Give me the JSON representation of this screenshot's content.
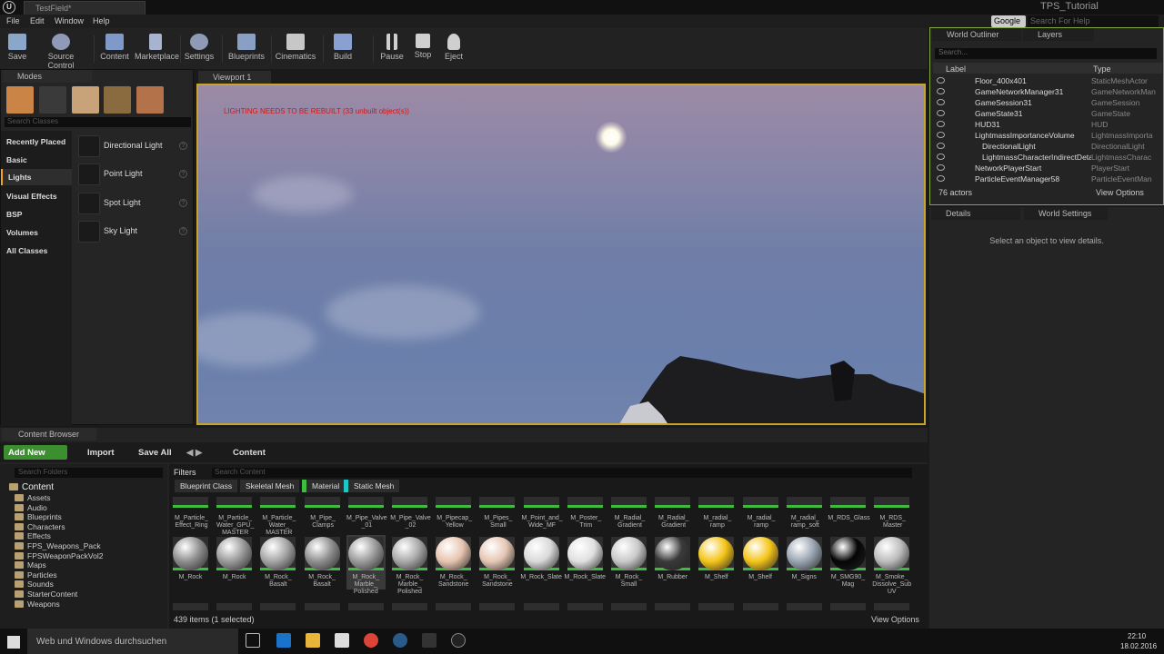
{
  "window": {
    "document_tab": "TestField*",
    "project_title": "TPS_Tutorial"
  },
  "menu": [
    "File",
    "Edit",
    "Window",
    "Help"
  ],
  "search_help": {
    "provider": "Google",
    "placeholder": "Search For Help"
  },
  "toolbar": [
    {
      "label": "Save",
      "icon": "save-icon",
      "color": "#8aa6c8"
    },
    {
      "label": "Source Control",
      "icon": "source-control-icon",
      "color": "#8e9ab8"
    },
    {
      "label": "Content",
      "icon": "content-icon",
      "color": "#7f9ac9"
    },
    {
      "label": "Marketplace",
      "icon": "marketplace-icon",
      "color": "#a8b4cf"
    },
    {
      "label": "Settings",
      "icon": "settings-icon",
      "color": "#8f9bb6"
    },
    {
      "label": "Blueprints",
      "icon": "blueprints-icon",
      "color": "#8a9fc4"
    },
    {
      "label": "Cinematics",
      "icon": "cinematics-icon",
      "color": "#c7c7c7"
    },
    {
      "label": "Build",
      "icon": "build-icon",
      "color": "#8aa0d0"
    },
    {
      "label": "Pause",
      "icon": "pause-icon",
      "color": "#cfcfcf"
    },
    {
      "label": "Stop",
      "icon": "stop-icon",
      "color": "#cfcfcf"
    },
    {
      "label": "Eject",
      "icon": "eject-icon",
      "color": "#cfcfcf"
    }
  ],
  "modes": {
    "tab": "Modes",
    "search_placeholder": "Search Classes",
    "categories": [
      "Recently Placed",
      "Basic",
      "Lights",
      "Visual Effects",
      "BSP",
      "Volumes",
      "All Classes"
    ],
    "selected_category": "Lights",
    "items": [
      "Directional Light",
      "Point Light",
      "Spot Light",
      "Sky Light"
    ]
  },
  "viewport": {
    "tab": "Viewport 1",
    "warning": "LIGHTING NEEDS TO BE REBUILT (33 unbuilt object(s))"
  },
  "outliner": {
    "tabs": [
      "World Outliner",
      "Layers"
    ],
    "search_placeholder": "Search...",
    "columns": [
      "Label",
      "Type"
    ],
    "rows": [
      {
        "label": "Floor_400x401",
        "type": "StaticMeshActor",
        "indent": 0
      },
      {
        "label": "GameNetworkManager31",
        "type": "GameNetworkMan",
        "indent": 0
      },
      {
        "label": "GameSession31",
        "type": "GameSession",
        "indent": 0
      },
      {
        "label": "GameState31",
        "type": "GameState",
        "indent": 0
      },
      {
        "label": "HUD31",
        "type": "HUD",
        "indent": 0
      },
      {
        "label": "LightmassImportanceVolume",
        "type": "LightmassImporta",
        "indent": 0
      },
      {
        "label": "DirectionalLight",
        "type": "DirectionalLight",
        "indent": 1
      },
      {
        "label": "LightmassCharacterIndirectDetai",
        "type": "LightmassCharac",
        "indent": 1
      },
      {
        "label": "NetworkPlayerStart",
        "type": "PlayerStart",
        "indent": 0
      },
      {
        "label": "ParticleEventManager58",
        "type": "ParticleEventMan",
        "indent": 0
      }
    ],
    "actor_count": "76 actors",
    "view_options": "View Options"
  },
  "details": {
    "tabs": [
      "Details",
      "World Settings"
    ],
    "empty_message": "Select an object to view details."
  },
  "content_browser": {
    "tab": "Content Browser",
    "add_new": "Add New",
    "import": "Import",
    "save_all": "Save All",
    "path": "Content",
    "folder_search_placeholder": "Search Folders",
    "asset_search_placeholder": "Search Content",
    "filters_label": "Filters",
    "filter_chips": [
      {
        "label": "Blueprint Class",
        "color": ""
      },
      {
        "label": "Skeletal Mesh",
        "color": ""
      },
      {
        "label": "Material",
        "color": "#3fbb3f"
      },
      {
        "label": "Static Mesh",
        "color": "#1fc6c6"
      }
    ],
    "root_folder": "Content",
    "folders": [
      "Assets",
      "Audio",
      "Blueprints",
      "Characters",
      "Effects",
      "FPS_Weapons_Pack",
      "FPSWeaponPackVol2",
      "Maps",
      "Particles",
      "Sounds",
      "StarterContent",
      "Weapons"
    ],
    "row1_names": [
      "M_Particle_ Effect_Ring",
      "M_Particle_ Water_GPU_ MASTER",
      "M_Particle_ Water_ MASTER",
      "M_Pipe_ Clamps",
      "M_Pipe_Valve _01",
      "M_Pipe_Valve _02",
      "M_Pipecap_ Yellow",
      "M_Pipes_ Small",
      "M_Point_and_ Wide_MF",
      "M_Poster_ Trim",
      "M_Radial_ Gradient",
      "M_Radial_ Gradient",
      "M_radial_ ramp",
      "M_radial_ ramp",
      "M_radial_ ramp_soft",
      "M_RDS_Glass",
      "M_RDS_ Master"
    ],
    "row2_names": [
      "M_Rock",
      "M_Rock",
      "M_Rock_ Basalt",
      "M_Rock_ Basalt",
      "M_Rock_ Marble_ Polished",
      "M_Rock_ Marble_ Polished",
      "M_Rock_ Sandstone",
      "M_Rock_ Sandstone",
      "M_Rock_Slate",
      "M_Rock_Slate",
      "M_Rock_ Small",
      "M_Rubber",
      "M_Shelf",
      "M_Shelf",
      "M_Signs",
      "M_SMG90_ Mag",
      "M_Smoke_ Dissolve_Sub UV"
    ],
    "item_count": "439 items (1 selected)",
    "view_options": "View Options"
  },
  "taskbar": {
    "search_placeholder": "Web und Windows durchsuchen",
    "time": "22:10",
    "date": "18.02.2016"
  },
  "colors": {
    "accent": "#f3a61c",
    "viewport_border": "#c9a32a",
    "outliner_border": "#86a93d",
    "add_new": "#3c8f2f",
    "warning": "#d51414"
  }
}
